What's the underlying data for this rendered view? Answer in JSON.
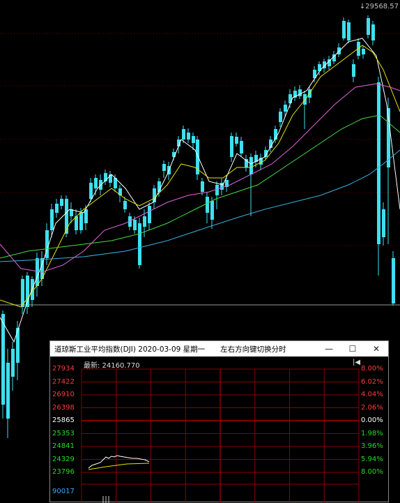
{
  "chart": {
    "high_price_label": "29568.57",
    "colors": {
      "up": "#ff3a3a",
      "down": "#3ee0ee",
      "ma5": "#ffffff",
      "ma10": "#e6e600",
      "ma20": "#e066e0",
      "ma30": "#44dd44",
      "ma60": "#3ab0e0",
      "grid": "#7a0000"
    }
  },
  "popup": {
    "title": "道琼斯工业平均指数(DJI) 2020-03-09 星期一",
    "hint": "左右方向键切换分时",
    "minimize_icon": "minimize-icon",
    "maximize_icon": "maximize-icon",
    "close_icon": "close-icon",
    "back_icon": "back-arrow-icon",
    "latest_label": "最新: 24160.770",
    "price_levels": [
      {
        "price": "27934",
        "pct": "8.00%",
        "color": "#ff3a3a"
      },
      {
        "price": "27422",
        "pct": "6.02%",
        "color": "#ff3a3a"
      },
      {
        "price": "26910",
        "pct": "4.04%",
        "color": "#ff3a3a"
      },
      {
        "price": "26398",
        "pct": "2.06%",
        "color": "#ff3a3a"
      },
      {
        "price": "25865",
        "pct": "0.00%",
        "color": "#ffffff"
      },
      {
        "price": "25353",
        "pct": "1.98%",
        "color": "#22dd22"
      },
      {
        "price": "24841",
        "pct": "3.96%",
        "color": "#22dd22"
      },
      {
        "price": "24329",
        "pct": "5.94%",
        "color": "#22dd22"
      },
      {
        "price": "23796",
        "pct": "8.00%",
        "color": "#22dd22"
      }
    ],
    "volume_label": "90017"
  }
}
